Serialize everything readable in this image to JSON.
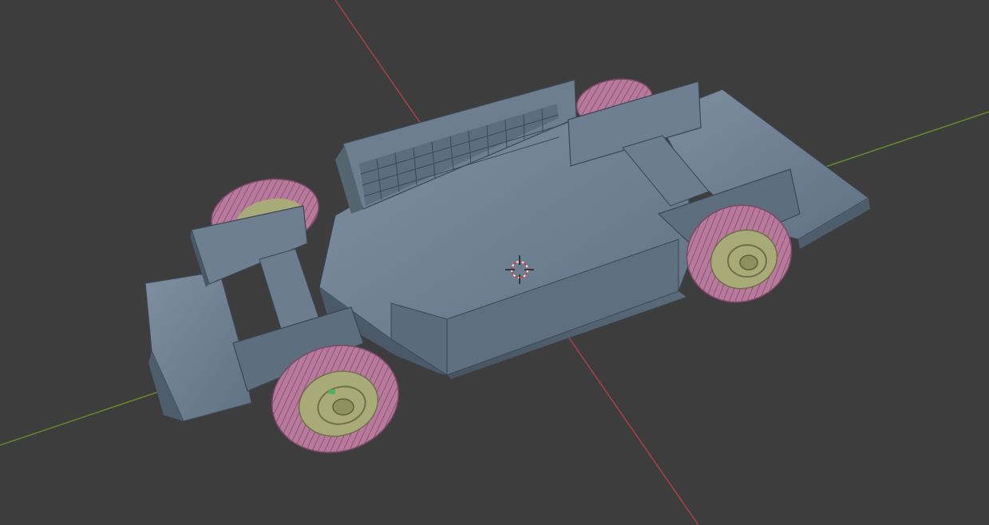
{
  "viewport": {
    "background": "#3d3d3d",
    "axis_x_color": "#b2404a",
    "axis_y_color": "#6a8f2a",
    "cursor_icon": "3d-cursor-icon"
  },
  "model": {
    "body_color": "#6f8192",
    "tire_color": "#b87a9c",
    "rim_color": "#a8aa78",
    "wheel_count": 4
  }
}
